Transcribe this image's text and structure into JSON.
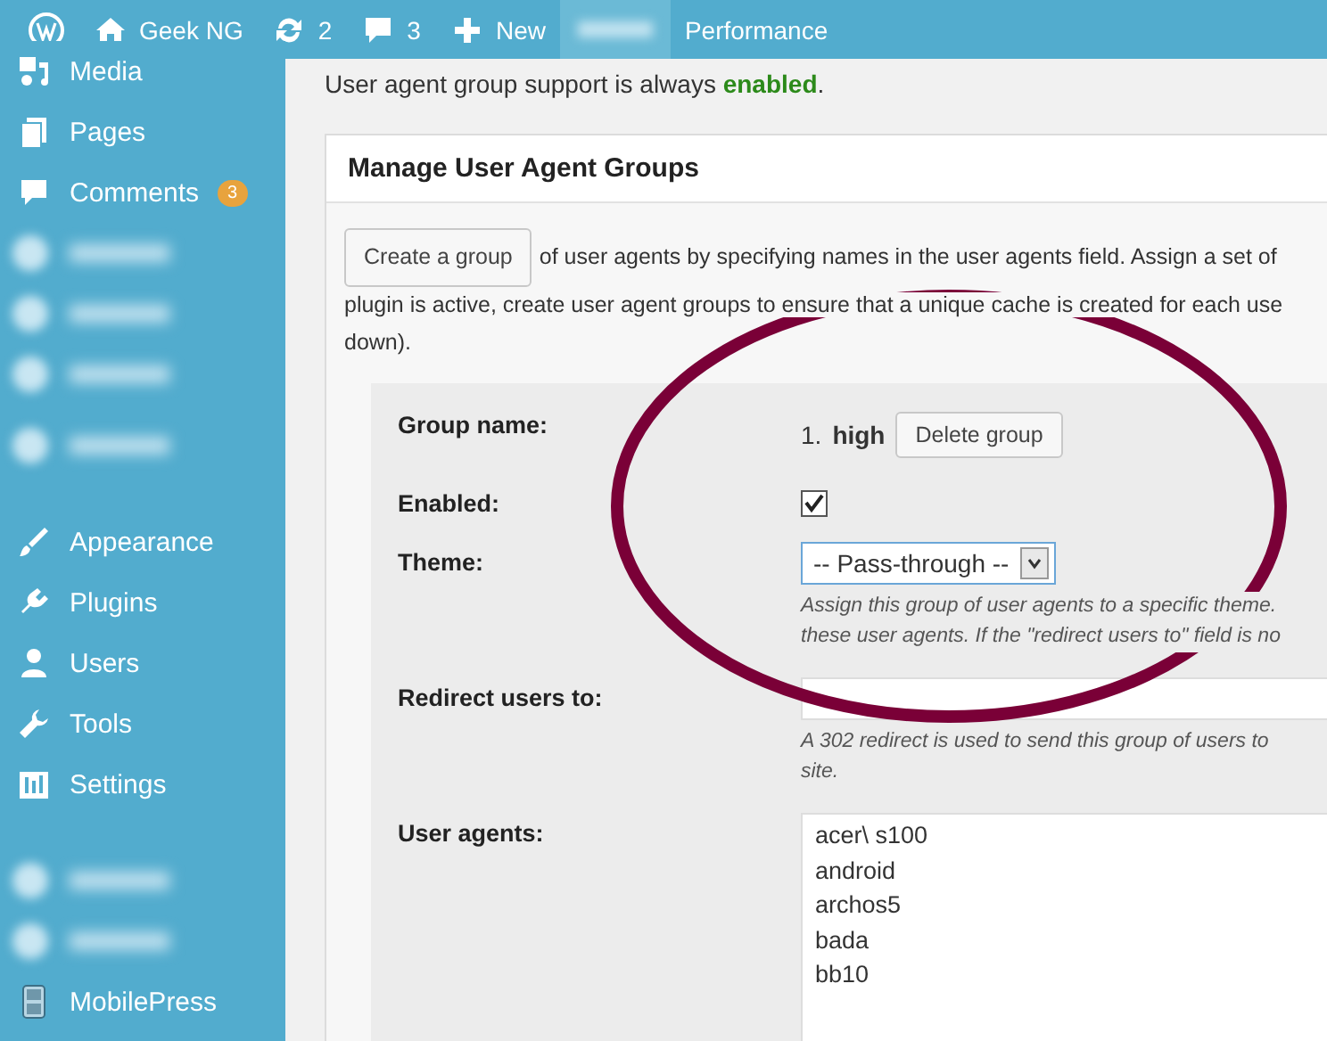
{
  "admin_bar": {
    "items": [
      {
        "kind": "logo"
      },
      {
        "kind": "site",
        "label": "Geek NG"
      },
      {
        "kind": "updates",
        "label": "2"
      },
      {
        "kind": "comments",
        "label": "3"
      },
      {
        "kind": "new",
        "label": "New"
      },
      {
        "kind": "blurred"
      },
      {
        "kind": "plain",
        "label": "Performance"
      }
    ]
  },
  "sidebar": {
    "items": [
      {
        "kind": "media",
        "label": "Media"
      },
      {
        "kind": "pages",
        "label": "Pages"
      },
      {
        "kind": "comments",
        "label": "Comments",
        "badge": "3"
      },
      {
        "kind": "blurred"
      },
      {
        "kind": "blurred"
      },
      {
        "kind": "blurred"
      },
      {
        "kind": "blurred"
      },
      {
        "kind": "appearance",
        "label": "Appearance"
      },
      {
        "kind": "plugins",
        "label": "Plugins"
      },
      {
        "kind": "users",
        "label": "Users"
      },
      {
        "kind": "tools",
        "label": "Tools"
      },
      {
        "kind": "settings",
        "label": "Settings"
      },
      {
        "kind": "blurred"
      },
      {
        "kind": "blurred"
      },
      {
        "kind": "phone",
        "label": "MobilePress"
      }
    ]
  },
  "notice": "User agent group support is always **enabled**.",
  "panel": {
    "title": "Manage User Agent Groups",
    "create_button": "Create a group",
    "intro_lines": [
      "of user agents by specifying names in the user agents field. Assign a set of",
      "plugin is active, create user agent groups to ensure that a unique cache is created for each use",
      "down)."
    ],
    "group": {
      "rows": [
        {
          "kind": "name",
          "label": "Group name:",
          "number": "1.",
          "value": "high",
          "button": "Delete group"
        },
        {
          "kind": "checkbox",
          "label": "Enabled:",
          "checked": true
        },
        {
          "kind": "select",
          "label": "Theme:",
          "value": "-- Pass-through --",
          "help_lines": [
            "Assign this group of user agents to a specific theme.",
            "these user agents. If the \"redirect users to\" field is no"
          ]
        },
        {
          "kind": "input",
          "label": "Redirect users to:",
          "help_lines": [
            "A 302 redirect is used to send this group of users to",
            "site."
          ]
        },
        {
          "kind": "textarea",
          "label": "User agents:",
          "lines": [
            "acer\\ s100",
            "android",
            "archos5",
            "bada",
            "bb10"
          ]
        }
      ]
    }
  }
}
